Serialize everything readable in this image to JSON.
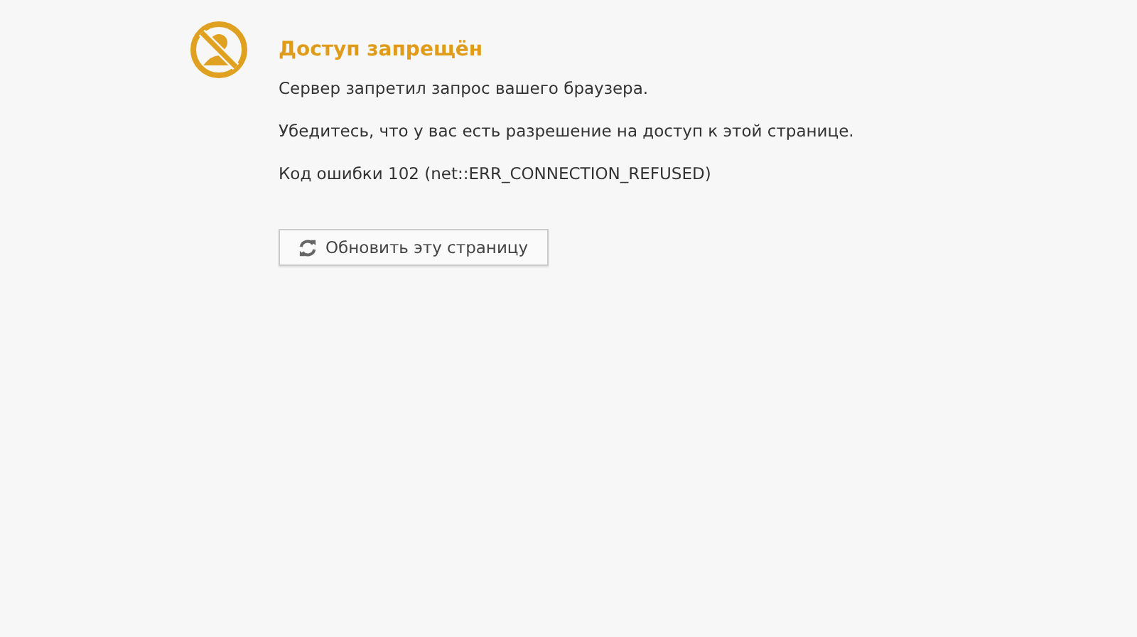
{
  "title": "Доступ запрещён",
  "messages": [
    "Сервер запретил запрос вашего браузера.",
    "Убедитесь, что у вас есть разрешение на доступ к этой странице."
  ],
  "error_code": "Код ошибки 102 (net::ERR_CONNECTION_REFUSED)",
  "reload_button": "Обновить эту страницу"
}
